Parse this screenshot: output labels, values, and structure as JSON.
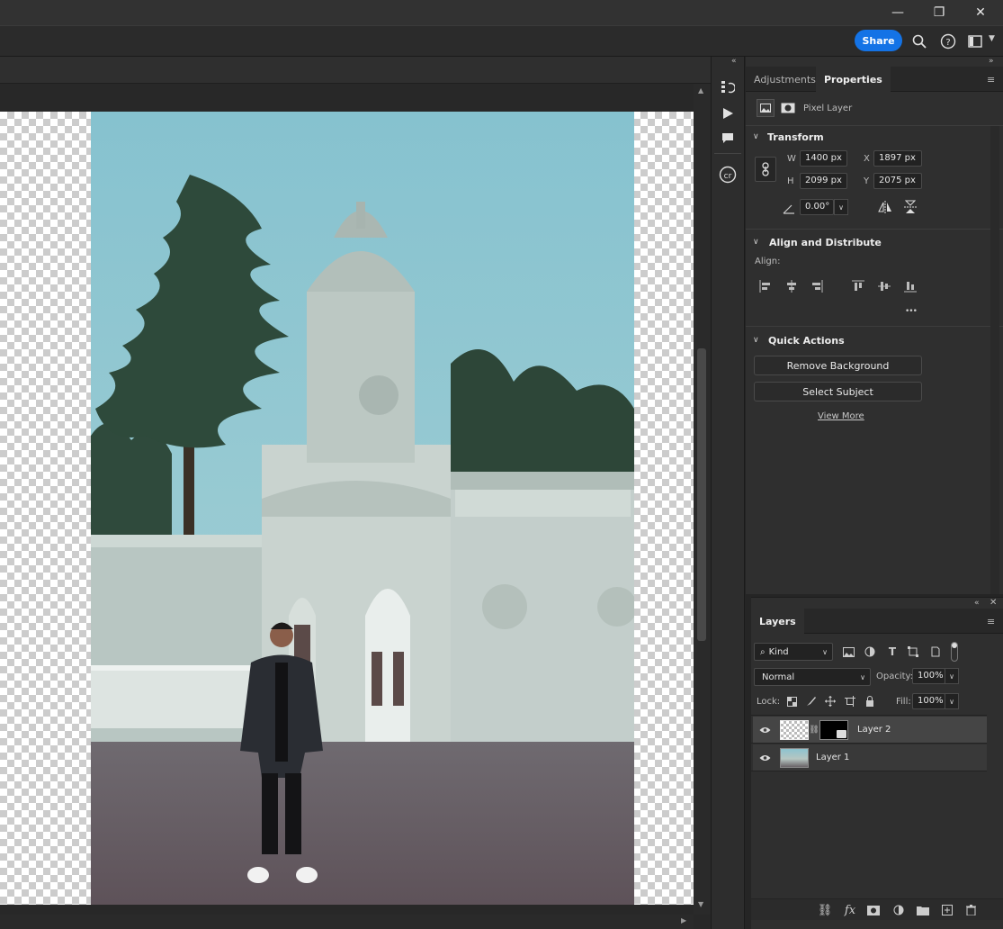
{
  "window": {
    "controls": {
      "minimize": "—",
      "restore": "❐",
      "close": "✕"
    }
  },
  "header": {
    "share_label": "Share",
    "icons": [
      "search-icon",
      "help-icon",
      "workspace-icon"
    ]
  },
  "properties_panel": {
    "tabs": [
      {
        "label": "Adjustments",
        "active": false
      },
      {
        "label": "Properties",
        "active": true
      }
    ],
    "layer_type_label": "Pixel Layer",
    "transform": {
      "title": "Transform",
      "w_label": "W",
      "w_value": "1400 px",
      "h_label": "H",
      "h_value": "2099 px",
      "x_label": "X",
      "x_value": "1897 px",
      "y_label": "Y",
      "y_value": "2075 px",
      "angle_value": "0.00°"
    },
    "align": {
      "title": "Align and Distribute",
      "align_label": "Align:",
      "more_label": "•••"
    },
    "quick_actions": {
      "title": "Quick Actions",
      "remove_bg_label": "Remove Background",
      "select_subject_label": "Select Subject",
      "view_more_label": "View More"
    }
  },
  "layers_panel": {
    "tab_label": "Layers",
    "filter_value": "Kind",
    "blend_mode": "Normal",
    "opacity_label": "Opacity:",
    "opacity_value": "100%",
    "lock_label": "Lock:",
    "fill_label": "Fill:",
    "fill_value": "100%",
    "layers": [
      {
        "name": "Layer 2",
        "visible": true,
        "selected": true,
        "has_mask": true
      },
      {
        "name": "Layer 1",
        "visible": true,
        "selected": false,
        "has_mask": false
      }
    ]
  },
  "colors": {
    "accent": "#1473e6",
    "panel": "#2f2f2f",
    "app_bg": "#252525"
  }
}
